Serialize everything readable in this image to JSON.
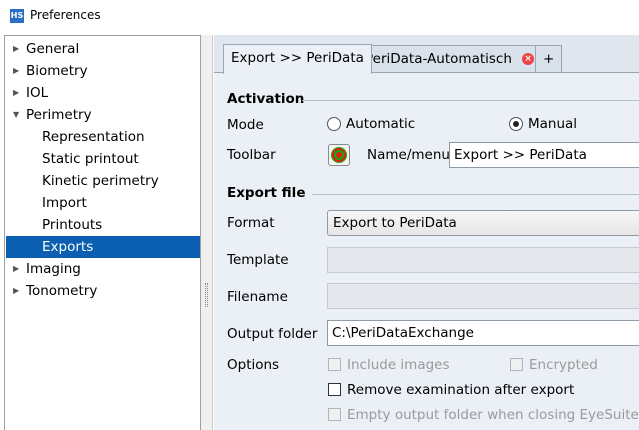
{
  "window": {
    "app_icon": "HS",
    "title": "Preferences"
  },
  "tree": {
    "items": [
      {
        "label": "General",
        "expanded": false,
        "level": 0
      },
      {
        "label": "Biometry",
        "expanded": false,
        "level": 0
      },
      {
        "label": "IOL",
        "expanded": false,
        "level": 0
      },
      {
        "label": "Perimetry",
        "expanded": true,
        "level": 0
      },
      {
        "label": "Representation",
        "level": 1
      },
      {
        "label": "Static printout",
        "level": 1
      },
      {
        "label": "Kinetic perimetry",
        "level": 1
      },
      {
        "label": "Import",
        "level": 1
      },
      {
        "label": "Printouts",
        "level": 1
      },
      {
        "label": "Exports",
        "level": 1,
        "selected": true
      },
      {
        "label": "Imaging",
        "expanded": false,
        "level": 0
      },
      {
        "label": "Tonometry",
        "expanded": false,
        "level": 0
      }
    ]
  },
  "tabs": [
    {
      "label": "Export >> PeriData",
      "active": true
    },
    {
      "label": "PeriData-Automatisch",
      "active": false,
      "closable": true
    },
    {
      "label": "+",
      "active": false
    }
  ],
  "activation": {
    "title": "Activation",
    "mode_label": "Mode",
    "mode_automatic": "Automatic",
    "mode_manual": "Manual",
    "selected_mode": "Manual",
    "toolbar_label": "Toolbar",
    "toolbar_icon": "target-icon",
    "name_menu_label": "Name/menu",
    "name_menu_value": "Export >> PeriData"
  },
  "export_file": {
    "title": "Export file",
    "format_label": "Format",
    "format_value": "Export to PeriData",
    "template_label": "Template",
    "template_value": "",
    "filename_label": "Filename",
    "filename_value": "",
    "output_folder_label": "Output folder",
    "output_folder_value": "C:\\PeriDataExchange",
    "options_label": "Options",
    "include_images": "Include images",
    "encrypted": "Encrypted",
    "remove_after_export": "Remove examination after export",
    "empty_output_folder": "Empty output folder when closing EyeSuite"
  },
  "colors": {
    "selection": "#0a5fb0",
    "panel": "#eaf0f6"
  }
}
